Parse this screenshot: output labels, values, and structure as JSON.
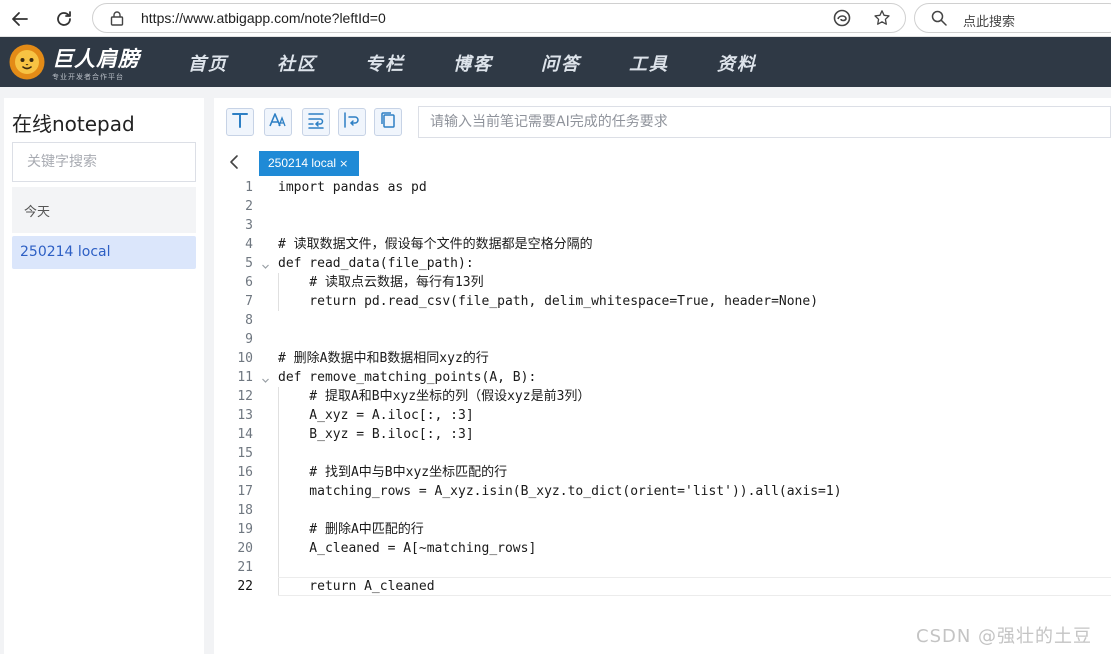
{
  "browser": {
    "url": "https://www.atbigapp.com/note?leftId=0",
    "search_placeholder": "点此搜索"
  },
  "site": {
    "logo_name": "巨人肩膀",
    "logo_tagline": "专业开发者合作平台",
    "nav": [
      "首页",
      "社区",
      "专栏",
      "博客",
      "问答",
      "工具",
      "资料"
    ]
  },
  "sidebar": {
    "title": "在线notepad",
    "search_placeholder": "关键字搜索",
    "group_label": "今天",
    "note_title": "250214 local"
  },
  "toolbar": {
    "icons": [
      "text-format-icon",
      "font-size-icon",
      "word-wrap-icon",
      "line-wrap-icon",
      "copy-icon"
    ],
    "ai_placeholder": "请输入当前笔记需要AI完成的任务要求"
  },
  "tab": {
    "label": "250214 local",
    "close": "×"
  },
  "editor": {
    "active_line": 22,
    "lines": [
      "import pandas as pd",
      "",
      "",
      "# 读取数据文件，假设每个文件的数据都是空格分隔的",
      "def read_data(file_path):",
      "    # 读取点云数据，每行有13列",
      "    return pd.read_csv(file_path, delim_whitespace=True, header=None)",
      "",
      "",
      "# 删除A数据中和B数据相同xyz的行",
      "def remove_matching_points(A, B):",
      "    # 提取A和B中xyz坐标的列（假设xyz是前3列）",
      "    A_xyz = A.iloc[:, :3]",
      "    B_xyz = B.iloc[:, :3]",
      "",
      "    # 找到A中与B中xyz坐标匹配的行",
      "    matching_rows = A_xyz.isin(B_xyz.to_dict(orient='list')).all(axis=1)",
      "",
      "    # 删除A中匹配的行",
      "    A_cleaned = A[~matching_rows]",
      "",
      "    return A_cleaned"
    ]
  },
  "watermark": "CSDN @强壮的土豆",
  "colors": {
    "site_nav_bg": "#2f3945",
    "tab_bg": "#1f8ad6",
    "selected_note_bg": "#dbe6fb",
    "selected_note_text": "#2d5fc4"
  }
}
